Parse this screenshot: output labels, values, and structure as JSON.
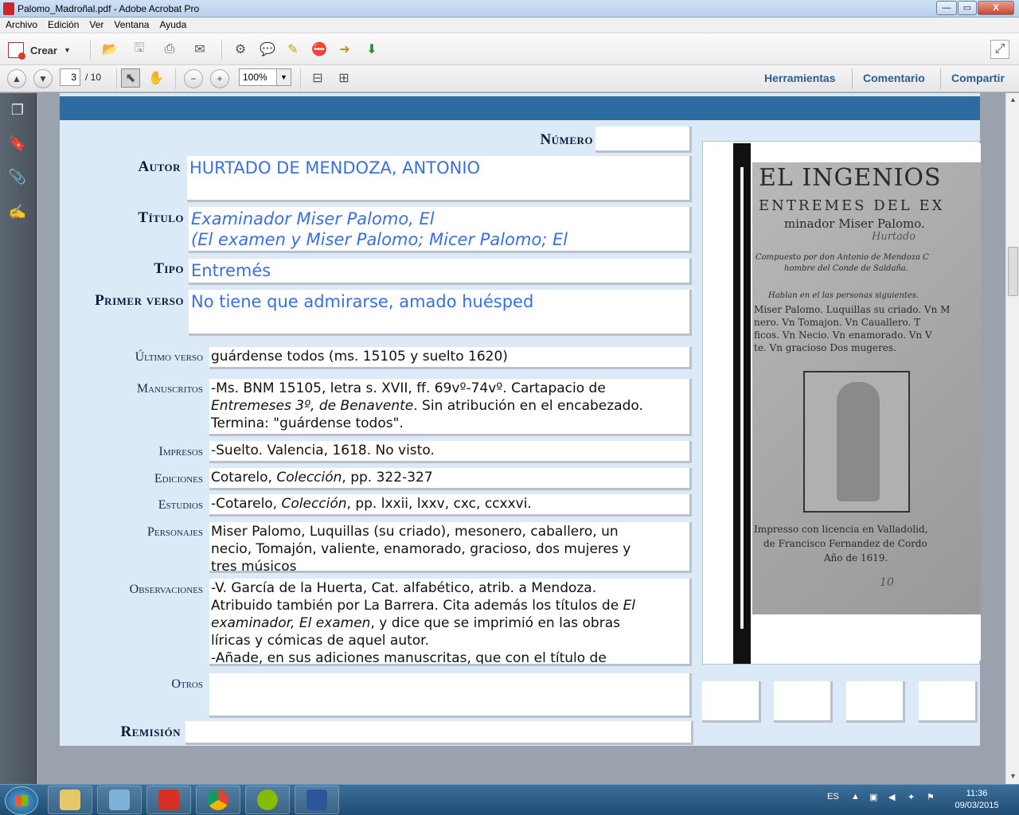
{
  "window": {
    "title": "Palomo_Madroñal.pdf - Adobe Acrobat Pro",
    "btn_min": "—",
    "btn_max": "▭",
    "btn_close": "X"
  },
  "menu": [
    "Archivo",
    "Edición",
    "Ver",
    "Ventana",
    "Ayuda"
  ],
  "toolbar": {
    "crear_label": "Crear"
  },
  "nav": {
    "page_current": "3",
    "page_total": "/ 10",
    "zoom": "100%"
  },
  "right_links": {
    "herramientas": "Herramientas",
    "comentario": "Comentario",
    "compartir": "Compartir"
  },
  "form": {
    "numero_label": "Número",
    "numero_value": "",
    "autor_label": "Autor",
    "autor_value": "HURTADO DE MENDOZA, ANTONIO",
    "titulo_label": "Título",
    "titulo_line1": "Examinador Miser Palomo, El",
    "titulo_line2": "(El examen y Miser Palomo; Micer Palomo; El",
    "tipo_label": "Tipo",
    "tipo_value": "Entremés",
    "primer_label": "Primer verso",
    "primer_value": "No tiene que admirarse, amado huésped",
    "ultimo_label": "Último verso",
    "ultimo_value": "guárdense todos (ms. 15105 y suelto 1620)",
    "manuscritos_label": "Manuscritos",
    "manuscritos_1": "-Ms. BNM 15105, letra s. XVII, ff. 69vº-74vº. Cartapacio de",
    "manuscritos_2a": "Entremeses 3º,  de Benavente",
    "manuscritos_2b": ". Sin atribución en el encabezado.",
    "manuscritos_3": "Termina: \"guárdense todos\".",
    "impresos_label": "Impresos",
    "impresos_value": "-Suelto. Valencia, 1618. No visto.",
    "ediciones_label": "Ediciones",
    "ediciones_a": "Cotarelo, ",
    "ediciones_b": "Colección",
    "ediciones_c": ", pp. 322-327",
    "estudios_label": "Estudios",
    "estudios_a": "-Cotarelo, ",
    "estudios_b": "Colección",
    "estudios_c": ", pp. lxxii, lxxv, cxc, ccxxvi.",
    "personajes_label": "Personajes",
    "personajes_1": "Miser Palomo, Luquillas (su criado), mesonero, caballero, un",
    "personajes_2": "necio, Tomajón, valiente, enamorado, gracioso, dos mujeres y",
    "personajes_3": "tres músicos",
    "observaciones_label": "Observaciones",
    "obs_1": "-V. García de la Huerta, Cat. alfabético, atrib. a Mendoza.",
    "obs_2a": "Atribuido también por La Barrera. Cita además los títulos de ",
    "obs_2b": "El",
    "obs_3a": "examinador, El examen",
    "obs_3b": ", y dice que se imprimió en las obras",
    "obs_4": "líricas y cómicas de aquel autor.",
    "obs_5": "-Añade, en sus adiciones manuscritas, que con el título de",
    "otros_label": "Otros",
    "otros_value": "",
    "remision_label": "Remisión",
    "remision_value": ""
  },
  "scan_text": {
    "line1": "EL INGENIOS",
    "line2": "ENTREMES DEL EX",
    "line3": "minador Miser Palomo.",
    "line4": "Hurtado",
    "line5": "Compuesto por don Antonio de Mendoza C",
    "line6": "hombre del Conde de Saldaña.",
    "line7": "Hablan en el las personas siguientes.",
    "line8": "Miser Palomo. Luquillas su criado. Vn M",
    "line9": "nero. Vn Tomajon. Vn Cauallero. T",
    "line10": "ficos. Vn Necio. Vn enamorado. Vn V",
    "line11": "te. Vn gracioso Dos mugeres.",
    "line12": "Impresso con licencia en Valladolid,",
    "line13": "de Francisco Fernandez de Cordo",
    "line14": "Año de 1619.",
    "line15": "10"
  },
  "taskbar": {
    "lang": "ES",
    "time": "11:36",
    "date": "09/03/2015"
  },
  "colors": {
    "header_blue": "#2d6ca1",
    "field_text_blue": "#3a6fe2",
    "page_bg": "#dce9f7"
  }
}
